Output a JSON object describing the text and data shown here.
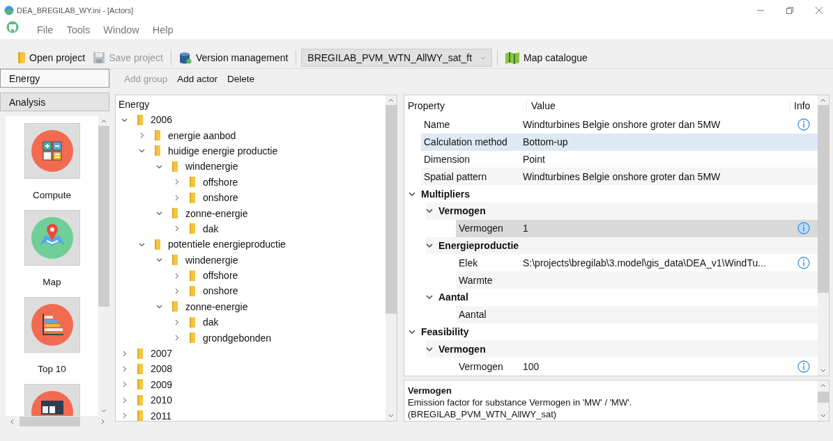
{
  "window": {
    "title": "DEA_BREGILAB_WY.ini - [Actors]"
  },
  "menu": [
    {
      "label": "File"
    },
    {
      "label": "Tools"
    },
    {
      "label": "Window"
    },
    {
      "label": "Help"
    }
  ],
  "toolbar": [
    {
      "kind": "folder",
      "label": "Open project",
      "disabled": false
    },
    {
      "kind": "save",
      "label": "Save project",
      "disabled": true
    },
    {
      "kind": "database",
      "label": "Version management",
      "disabled": false
    },
    {
      "kind": "dropdown",
      "label": "BREGILAB_PVM_WTN_AllWY_sat_ft",
      "disabled": false
    },
    {
      "kind": "map",
      "label": "Map catalogue",
      "disabled": false
    }
  ],
  "sidebar": {
    "sections": [
      {
        "label": "Energy",
        "selected": true
      },
      {
        "label": "Analysis",
        "selected": false
      }
    ],
    "tools": [
      {
        "kind": "calculator",
        "label": "Compute"
      },
      {
        "kind": "map",
        "label": "Map"
      },
      {
        "kind": "chart",
        "label": "Top 10"
      },
      {
        "kind": "table"
      }
    ]
  },
  "actions": [
    {
      "label": "Add group",
      "disabled": true
    },
    {
      "label": "Add actor",
      "disabled": false
    },
    {
      "label": "Delete",
      "disabled": false
    }
  ],
  "tree": {
    "header": "Energy",
    "items": [
      {
        "label": "2006",
        "expanded": true,
        "children": [
          {
            "label": "energie aanbod",
            "expanded": false
          },
          {
            "label": "huidige energie productie",
            "expanded": true,
            "children": [
              {
                "label": "windenergie",
                "expanded": true,
                "children": [
                  {
                    "label": "offshore",
                    "expanded": false
                  },
                  {
                    "label": "onshore",
                    "expanded": false
                  }
                ]
              },
              {
                "label": "zonne-energie",
                "expanded": true,
                "children": [
                  {
                    "label": "dak",
                    "expanded": false
                  }
                ]
              }
            ]
          },
          {
            "label": "potentiele energieproductie",
            "expanded": true,
            "children": [
              {
                "label": "windenergie",
                "expanded": true,
                "children": [
                  {
                    "label": "offshore",
                    "expanded": false
                  },
                  {
                    "label": "onshore",
                    "expanded": false
                  }
                ]
              },
              {
                "label": "zonne-energie",
                "expanded": true,
                "children": [
                  {
                    "label": "dak",
                    "expanded": false
                  },
                  {
                    "label": "grondgebonden",
                    "expanded": false
                  }
                ]
              }
            ]
          }
        ]
      },
      {
        "label": "2007",
        "expanded": false
      },
      {
        "label": "2008",
        "expanded": false
      },
      {
        "label": "2009",
        "expanded": false
      },
      {
        "label": "2010",
        "expanded": false
      },
      {
        "label": "2011",
        "expanded": false
      }
    ]
  },
  "properties": {
    "columns": [
      "Property",
      "Value",
      "Info"
    ],
    "rows": [
      {
        "kind": "property",
        "label": "Name",
        "value": "Windturbines Belgie onshore groter dan 5MW",
        "info": true,
        "selected": false,
        "hovered": false
      },
      {
        "kind": "property",
        "label": "Calculation method",
        "value": "Bottom-up",
        "info": false,
        "selected": true,
        "hovered": false
      },
      {
        "kind": "property",
        "label": "Dimension",
        "value": "Point",
        "info": false,
        "selected": false,
        "hovered": false
      },
      {
        "kind": "property",
        "label": "Spatial pattern",
        "value": "Windturbines Belgie onshore groter dan 5MW",
        "info": false,
        "selected": false,
        "hovered": false
      },
      {
        "kind": "group",
        "label": "Multipliers",
        "expanded": true,
        "selected": false,
        "hovered": false,
        "children": [
          {
            "kind": "group",
            "label": "Vermogen",
            "expanded": true,
            "selected": false,
            "hovered": false,
            "children": [
              {
                "kind": "property",
                "label": "Vermogen",
                "value": "1",
                "info": true,
                "selected": false,
                "hovered": true
              }
            ]
          },
          {
            "kind": "group",
            "label": "Energieproductie",
            "expanded": true,
            "selected": false,
            "hovered": false,
            "children": [
              {
                "kind": "property",
                "label": "Elek",
                "value": "S:\\projects\\bregilab\\3.model\\gis_data\\DEA_v1\\WindTu...",
                "info": true,
                "selected": false,
                "hovered": false
              },
              {
                "kind": "property",
                "label": "Warmte",
                "info": false,
                "selected": false,
                "hovered": false
              }
            ]
          },
          {
            "kind": "group",
            "label": "Aantal",
            "expanded": true,
            "selected": false,
            "hovered": false,
            "children": [
              {
                "kind": "property",
                "label": "Aantal",
                "info": false,
                "selected": false,
                "hovered": false
              }
            ]
          }
        ]
      },
      {
        "kind": "group",
        "label": "Feasibility",
        "expanded": true,
        "selected": false,
        "hovered": false,
        "children": [
          {
            "kind": "group",
            "label": "Vermogen",
            "expanded": true,
            "selected": false,
            "hovered": false,
            "children": [
              {
                "kind": "property",
                "label": "Vermogen",
                "value": "100",
                "info": true,
                "selected": false,
                "hovered": false
              }
            ]
          }
        ]
      }
    ]
  },
  "description": {
    "title": "Vermogen",
    "lines": [
      "Emission factor for substance Vermogen in 'MW' / 'MW'.",
      "(BREGILAB_PVM_WTN_AllWY_sat)"
    ]
  }
}
